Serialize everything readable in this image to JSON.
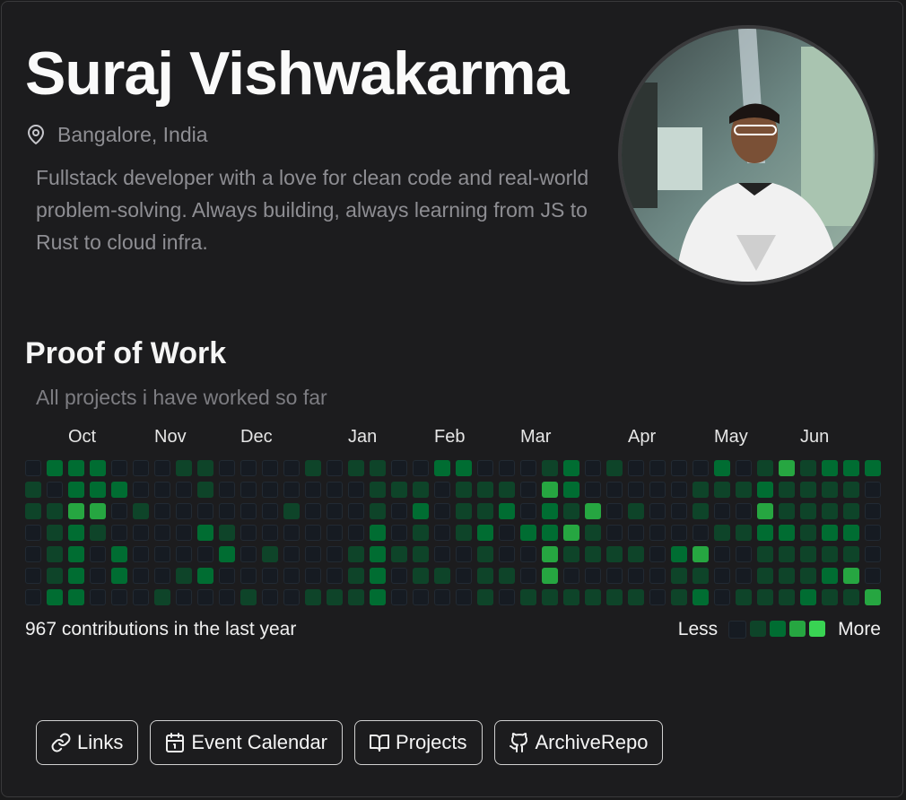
{
  "profile": {
    "name": "Suraj Vishwakarma",
    "location": "Bangalore, India",
    "bio": "Fullstack developer with a love for clean code and real-world problem-solving. Always building, always learning from JS to Rust to cloud infra.",
    "avatar_icon": "person-photo"
  },
  "section": {
    "title": "Proof of Work",
    "subtitle": "All projects i have worked so far"
  },
  "contributions": {
    "months": [
      "Oct",
      "Nov",
      "Dec",
      "Jan",
      "Feb",
      "Mar",
      "Apr",
      "May",
      "Jun"
    ],
    "summary": "967 contributions in the last year",
    "legend_less": "Less",
    "legend_more": "More",
    "colors": [
      "#161b22",
      "#0e4429",
      "#006d32",
      "#26a641",
      "#39d353"
    ],
    "weeks": [
      [
        0,
        1,
        1,
        0,
        0,
        0,
        0
      ],
      [
        2,
        0,
        1,
        1,
        1,
        1,
        2
      ],
      [
        2,
        2,
        3,
        2,
        2,
        2,
        2
      ],
      [
        2,
        2,
        3,
        1,
        0,
        0,
        0
      ],
      [
        0,
        2,
        0,
        0,
        2,
        2,
        0
      ],
      [
        0,
        0,
        1,
        0,
        0,
        0,
        0
      ],
      [
        0,
        0,
        0,
        0,
        0,
        0,
        1
      ],
      [
        1,
        0,
        0,
        0,
        0,
        1,
        0
      ],
      [
        1,
        1,
        0,
        2,
        0,
        2,
        0
      ],
      [
        0,
        0,
        0,
        1,
        2,
        0,
        0
      ],
      [
        0,
        0,
        0,
        0,
        0,
        0,
        1
      ],
      [
        0,
        0,
        0,
        0,
        1,
        0,
        0
      ],
      [
        0,
        0,
        1,
        0,
        0,
        0,
        0
      ],
      [
        1,
        0,
        0,
        0,
        0,
        0,
        1
      ],
      [
        0,
        0,
        0,
        0,
        0,
        0,
        1
      ],
      [
        1,
        0,
        0,
        0,
        1,
        1,
        1
      ],
      [
        1,
        1,
        1,
        2,
        2,
        2,
        2
      ],
      [
        0,
        1,
        0,
        0,
        1,
        0,
        0
      ],
      [
        0,
        1,
        2,
        1,
        1,
        1,
        0
      ],
      [
        2,
        0,
        0,
        0,
        0,
        1,
        0
      ],
      [
        2,
        1,
        1,
        1,
        0,
        0,
        0
      ],
      [
        0,
        1,
        1,
        2,
        1,
        1,
        1
      ],
      [
        0,
        1,
        2,
        0,
        0,
        1,
        0
      ],
      [
        0,
        0,
        0,
        2,
        0,
        0,
        1
      ],
      [
        1,
        3,
        2,
        2,
        3,
        3,
        1
      ],
      [
        2,
        2,
        1,
        3,
        1,
        0,
        1
      ],
      [
        0,
        0,
        3,
        1,
        1,
        0,
        1
      ],
      [
        1,
        0,
        0,
        0,
        1,
        0,
        1
      ],
      [
        0,
        0,
        1,
        0,
        1,
        0,
        1
      ],
      [
        0,
        0,
        0,
        0,
        0,
        0,
        0
      ],
      [
        0,
        0,
        0,
        0,
        2,
        1,
        1
      ],
      [
        0,
        1,
        1,
        0,
        3,
        1,
        2
      ],
      [
        2,
        1,
        0,
        1,
        0,
        0,
        0
      ],
      [
        0,
        1,
        0,
        1,
        0,
        0,
        1
      ],
      [
        1,
        2,
        3,
        2,
        1,
        1,
        1
      ],
      [
        3,
        1,
        1,
        2,
        1,
        1,
        1
      ],
      [
        1,
        1,
        1,
        1,
        1,
        1,
        2
      ],
      [
        2,
        1,
        1,
        2,
        1,
        2,
        1
      ],
      [
        2,
        1,
        1,
        2,
        1,
        3,
        1
      ],
      [
        2,
        0,
        0,
        0,
        0,
        0,
        3
      ]
    ]
  },
  "buttons": [
    {
      "label": "Links",
      "icon": "link-icon"
    },
    {
      "label": "Event Calendar",
      "icon": "calendar-icon"
    },
    {
      "label": "Projects",
      "icon": "book-icon"
    },
    {
      "label": "ArchiveRepo",
      "icon": "github-icon"
    }
  ]
}
